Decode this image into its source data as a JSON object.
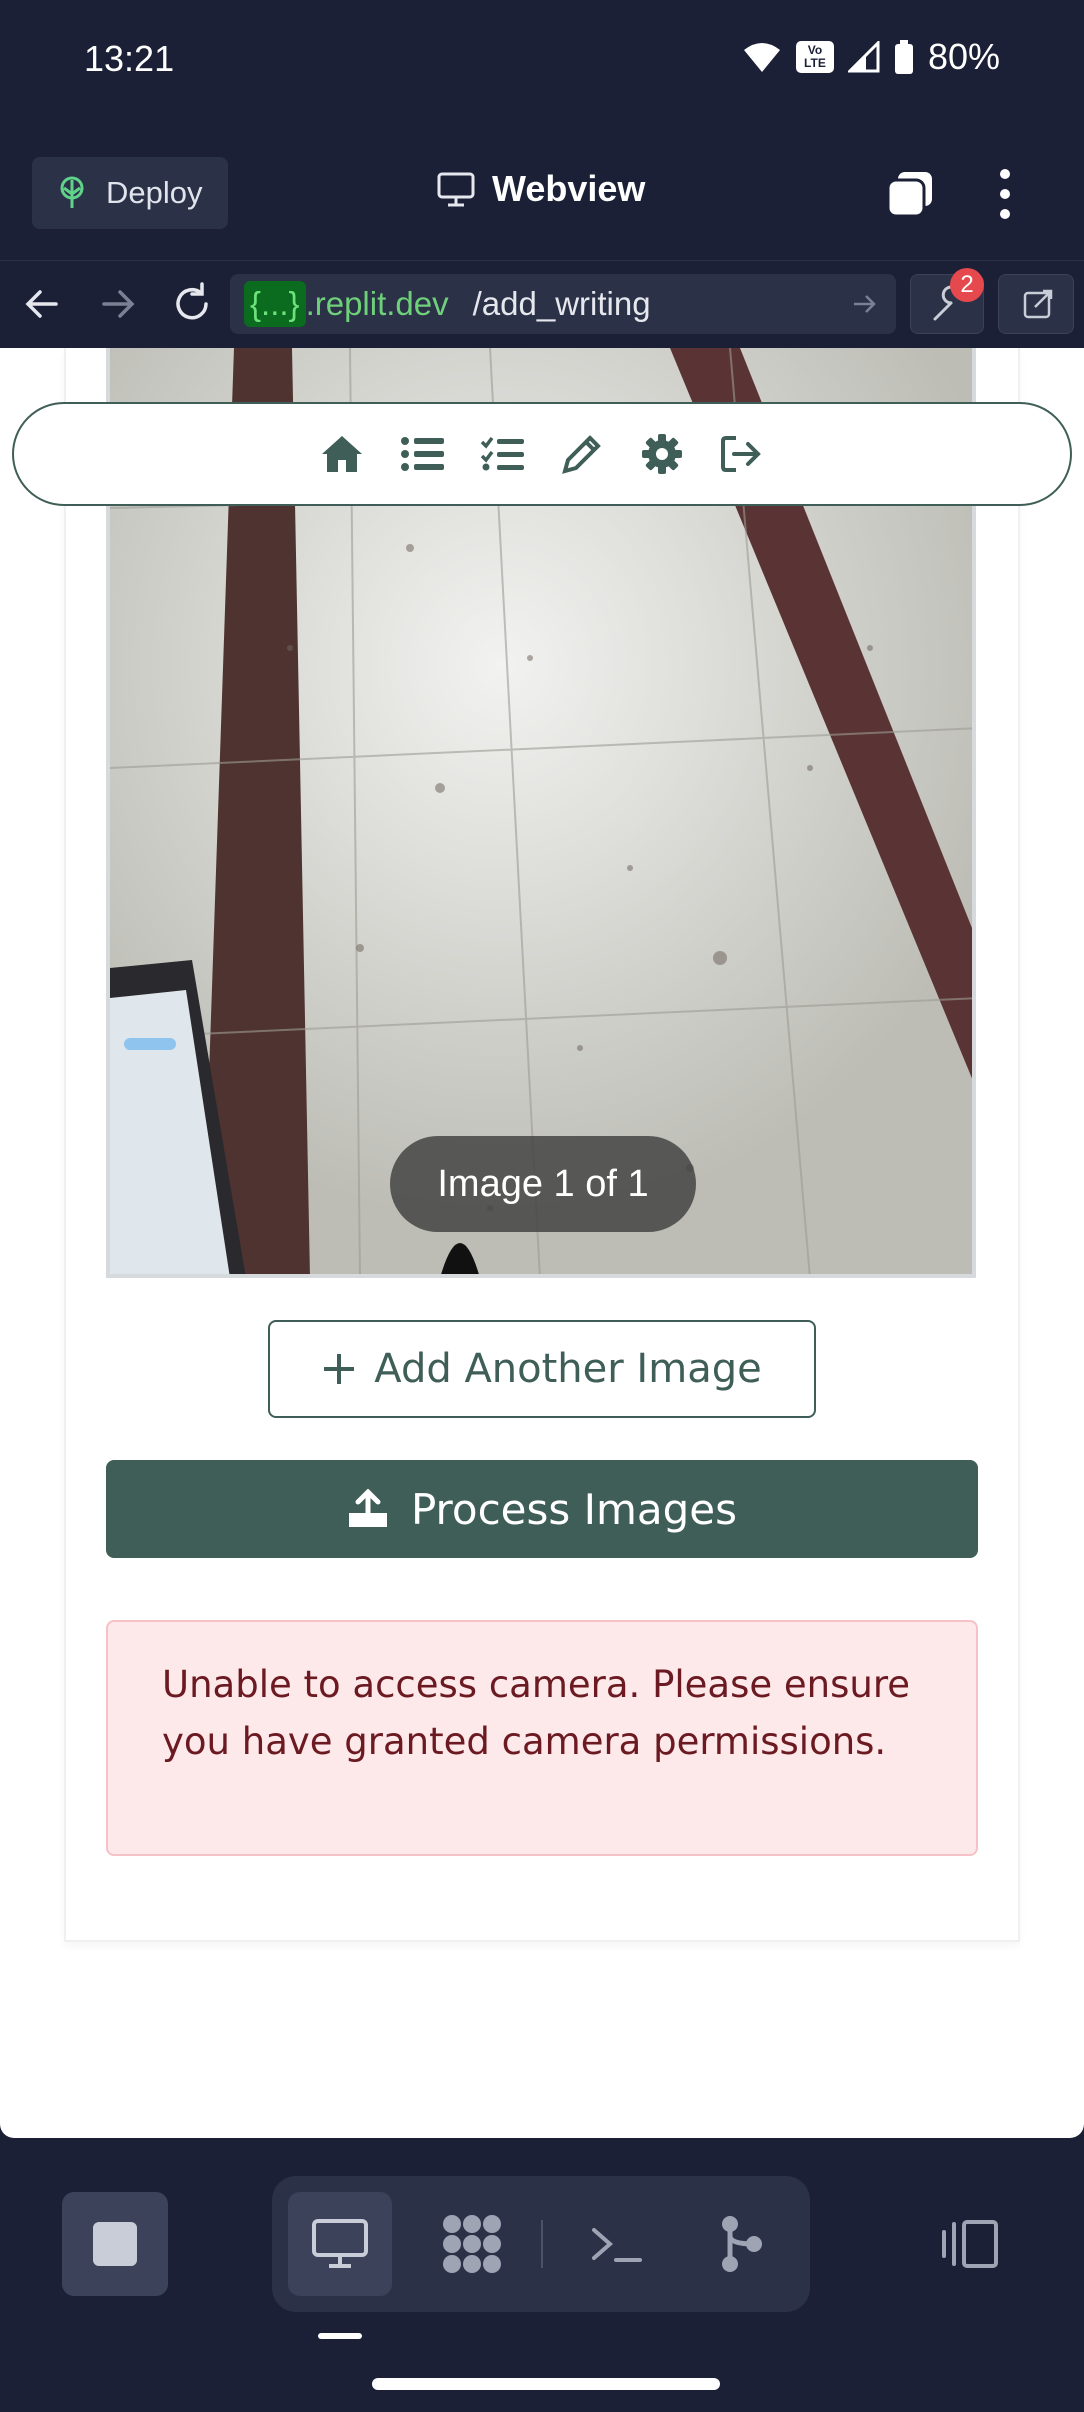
{
  "status_bar": {
    "time": "13:21",
    "battery": "80%",
    "volte_line1": "Vo",
    "volte_line2": "LTE"
  },
  "header": {
    "deploy_label": "Deploy",
    "title": "Webview"
  },
  "url_bar": {
    "chip": "{...}",
    "domain": ".replit.dev",
    "path": "/add_writing",
    "devtools_badge": "2"
  },
  "page": {
    "navbar": {
      "icons": [
        "home-icon",
        "list-icon",
        "checklist-icon",
        "pencil-icon",
        "gear-icon",
        "logout-icon"
      ]
    },
    "image_counter": "Image 1 of 1",
    "add_image_label": "Add Another Image",
    "process_label": "Process Images",
    "error_message": "Unable to access camera. Please ensure you have granted camera permissions."
  },
  "colors": {
    "accent": "#3f5e57",
    "error_bg": "#fde8ea",
    "error_text": "#6b1a22",
    "replit_bg": "#1b2036"
  }
}
